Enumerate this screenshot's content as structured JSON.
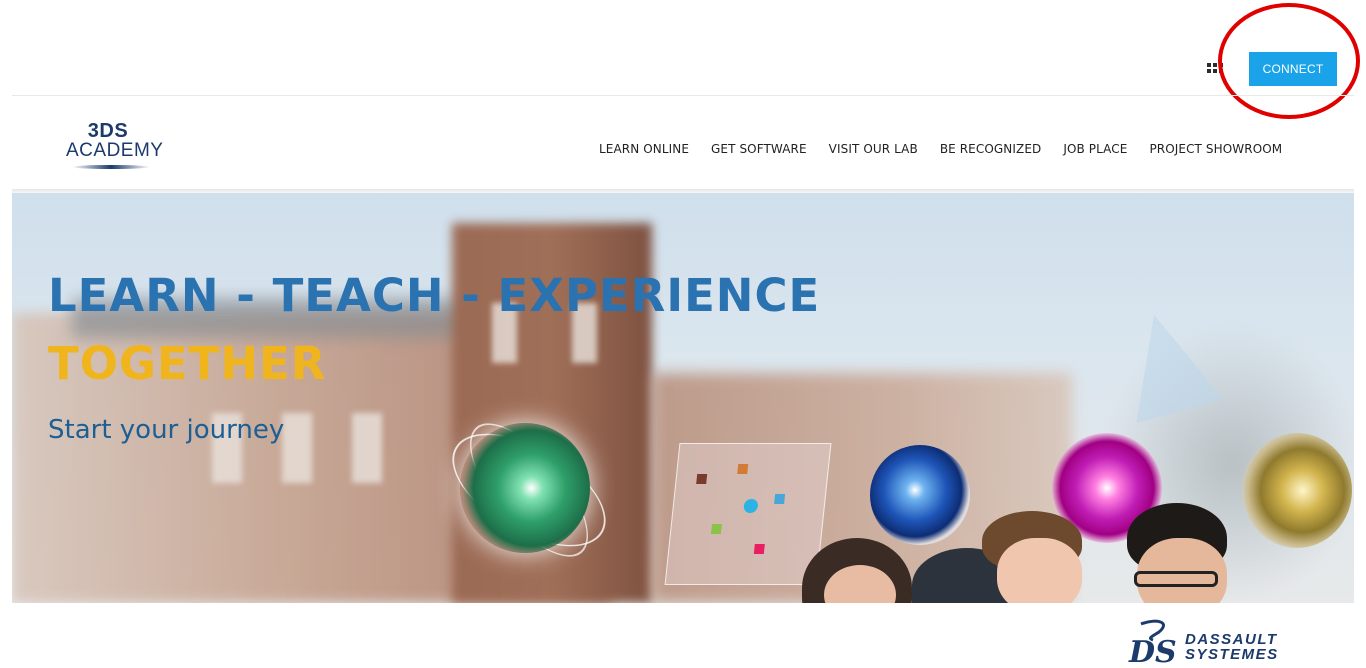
{
  "topbar": {
    "apps_icon": "apps-grid-icon",
    "connect_label": "CONNECT",
    "annotation_color": "#e00000",
    "connect_color": "#1aa3e8"
  },
  "header": {
    "logo": {
      "line1": "3DS",
      "line2": "ACADEMY"
    },
    "nav": [
      {
        "label": "LEARN ONLINE"
      },
      {
        "label": "GET SOFTWARE"
      },
      {
        "label": "VISIT OUR LAB"
      },
      {
        "label": "BE RECOGNIZED"
      },
      {
        "label": "JOB PLACE"
      },
      {
        "label": "PROJECT SHOWROOM"
      }
    ]
  },
  "hero": {
    "title": "LEARN - TEACH - EXPERIENCE",
    "subtitle": "TOGETHER",
    "cta": "Start your journey",
    "title_color": "#2a73b0",
    "subtitle_color": "#f0b51c"
  },
  "footer": {
    "brand_line1": "DASSAULT",
    "brand_line2": "SYSTEMES"
  }
}
